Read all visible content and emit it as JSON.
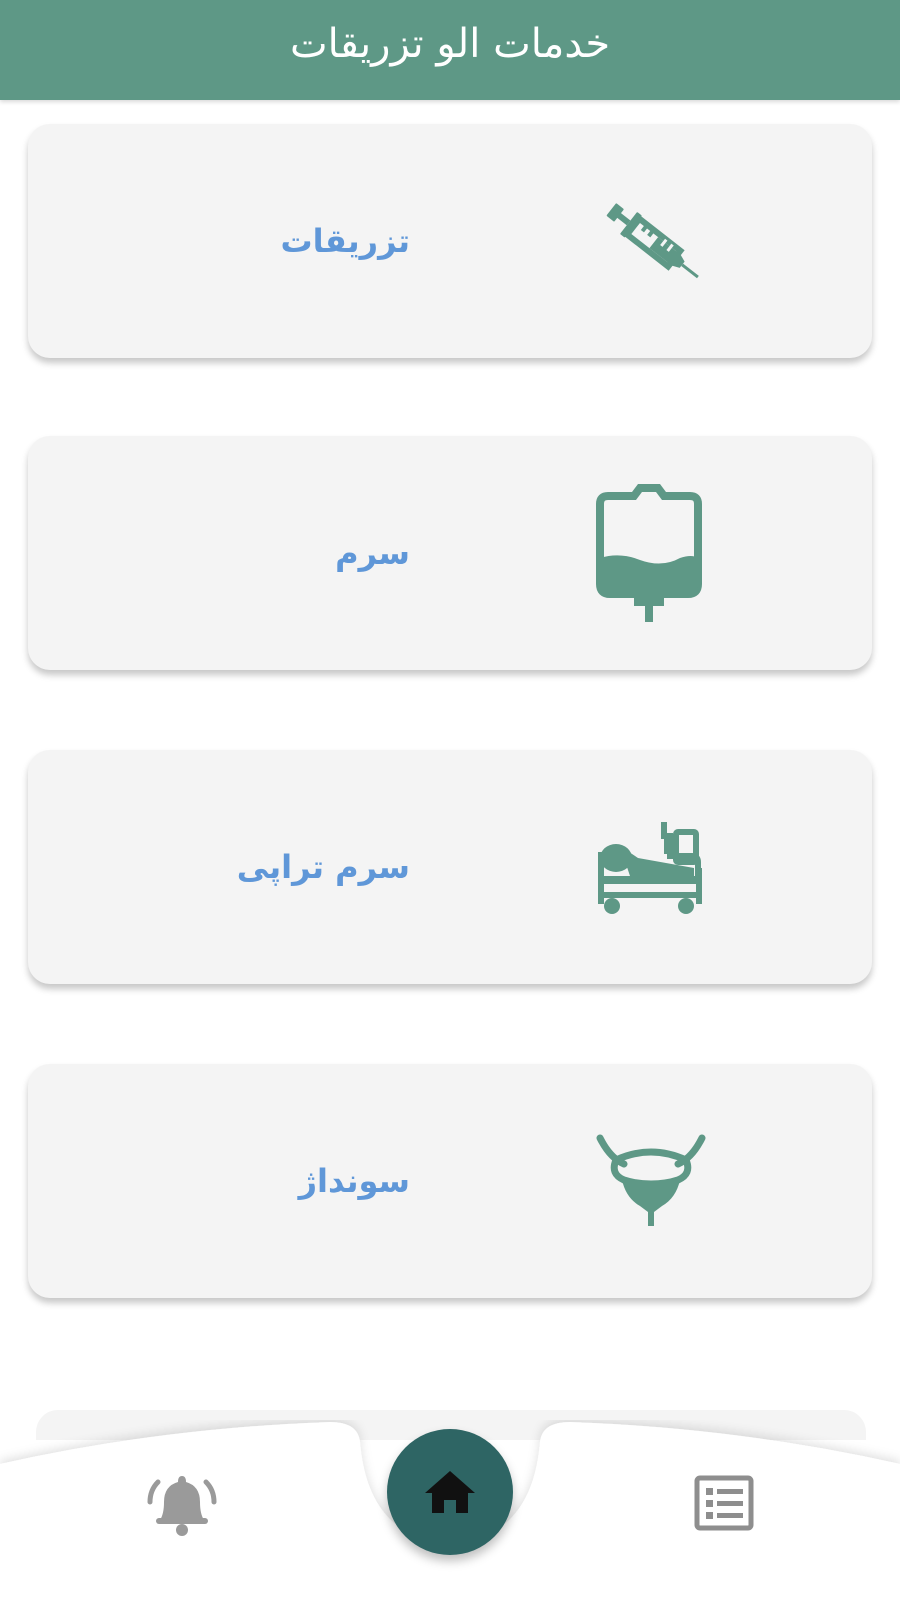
{
  "app": {
    "title": "خدمات الو تزریقات",
    "colors": {
      "header": "#5e9886",
      "icon": "#5e9886",
      "label": "#5f97d8",
      "home_button": "#2e6564"
    }
  },
  "services": [
    {
      "label": "تزریقات",
      "icon": "syringe-icon"
    },
    {
      "label": "سرم",
      "icon": "iv-bag-icon"
    },
    {
      "label": "سرم تراپی",
      "icon": "hospital-bed-icon"
    },
    {
      "label": "سونداژ",
      "icon": "bladder-icon"
    }
  ],
  "nav": {
    "items": [
      {
        "icon": "bell-icon"
      },
      {
        "icon": "home-icon"
      },
      {
        "icon": "list-icon"
      }
    ]
  }
}
